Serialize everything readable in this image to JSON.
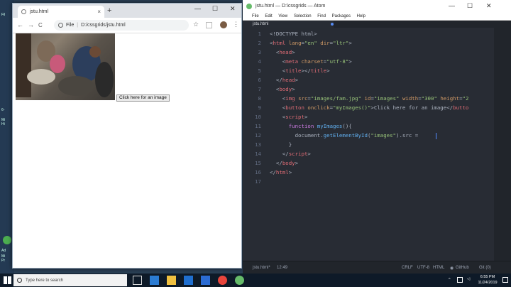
{
  "desktop": {
    "texts": [
      "Fil",
      "6-",
      "Mi",
      "Hi",
      "Ad",
      "Mi",
      "Pr"
    ]
  },
  "chrome": {
    "tab_title": "jstu.html",
    "tab_close": "×",
    "new_tab": "+",
    "win_min": "—",
    "win_max": "☐",
    "win_close": "✕",
    "back": "←",
    "forward": "→",
    "reload": "C",
    "url_scheme": "File",
    "url": "D:/cssgrids/jstu.html",
    "page_button": "Click here for an image"
  },
  "atom": {
    "title": "jstu.html — D:\\cssgrids — Atom",
    "menu": [
      "File",
      "Edit",
      "View",
      "Selection",
      "Find",
      "Packages",
      "Help"
    ],
    "tab": "jstu.html",
    "lines": [
      {
        "n": "1",
        "html": "&lt;!DOCTYPE html&gt;"
      },
      {
        "n": "2",
        "html": "&lt;<span class='t'>html</span> <span class='at'>lang</span>=<span class='s'>\"en\"</span> <span class='at'>dir</span>=<span class='s'>\"ltr\"</span>&gt;"
      },
      {
        "n": "3",
        "html": "  &lt;<span class='t'>head</span>&gt;"
      },
      {
        "n": "4",
        "html": "    &lt;<span class='t'>meta</span> <span class='at'>charset</span>=<span class='s'>\"utf-8\"</span>&gt;"
      },
      {
        "n": "5",
        "html": "    &lt;<span class='t'>title</span>&gt;&lt;/<span class='t'>title</span>&gt;"
      },
      {
        "n": "6",
        "html": "  &lt;/<span class='t'>head</span>&gt;"
      },
      {
        "n": "7",
        "html": "  &lt;<span class='t'>body</span>&gt;"
      },
      {
        "n": "8",
        "html": "    &lt;<span class='t'>img</span> <span class='at'>src</span>=<span class='s'>\"images/fam.jpg\"</span> <span class='at'>id</span>=<span class='s'>\"images\"</span> <span class='at'>width</span>=<span class='s'>\"300\"</span> <span class='at'>height</span>=<span class='s'>\"2</span>"
      },
      {
        "n": "9",
        "html": "    &lt;<span class='t'>button</span> <span class='at'>onclick</span>=<span class='s'>\"myImages()\"</span>&gt;Click here for an image&lt;/<span class='t'>butto</span>"
      },
      {
        "n": "10",
        "html": "    &lt;<span class='t'>script</span>&gt;"
      },
      {
        "n": "11",
        "html": "      <span class='k'>function</span> <span class='f'>myImages</span>(){"
      },
      {
        "n": "12",
        "html": "        document.<span class='f'>getElementById</span>(<span class='s'>\"images\"</span>).src = "
      },
      {
        "n": "13",
        "html": "      }"
      },
      {
        "n": "14",
        "html": "    &lt;/<span class='t'>script</span>&gt;"
      },
      {
        "n": "15",
        "html": "  &lt;/<span class='t'>body</span>&gt;"
      },
      {
        "n": "16",
        "html": "&lt;/<span class='t'>html</span>&gt;"
      },
      {
        "n": "17",
        "html": ""
      }
    ],
    "status": {
      "file": "jstu.html*",
      "pos": "12:49",
      "eol": "CRLF",
      "enc": "UTF-8",
      "grammar": "HTML",
      "github": "GitHub",
      "git": "Git (0)"
    }
  },
  "taskbar": {
    "search_placeholder": "Type here to search",
    "time": "6:55 PM",
    "date": "11/24/2019"
  },
  "colors": {
    "desktop": "#2a3f55",
    "atom_bg": "#282c34",
    "taskbar": "#0e1a28"
  }
}
